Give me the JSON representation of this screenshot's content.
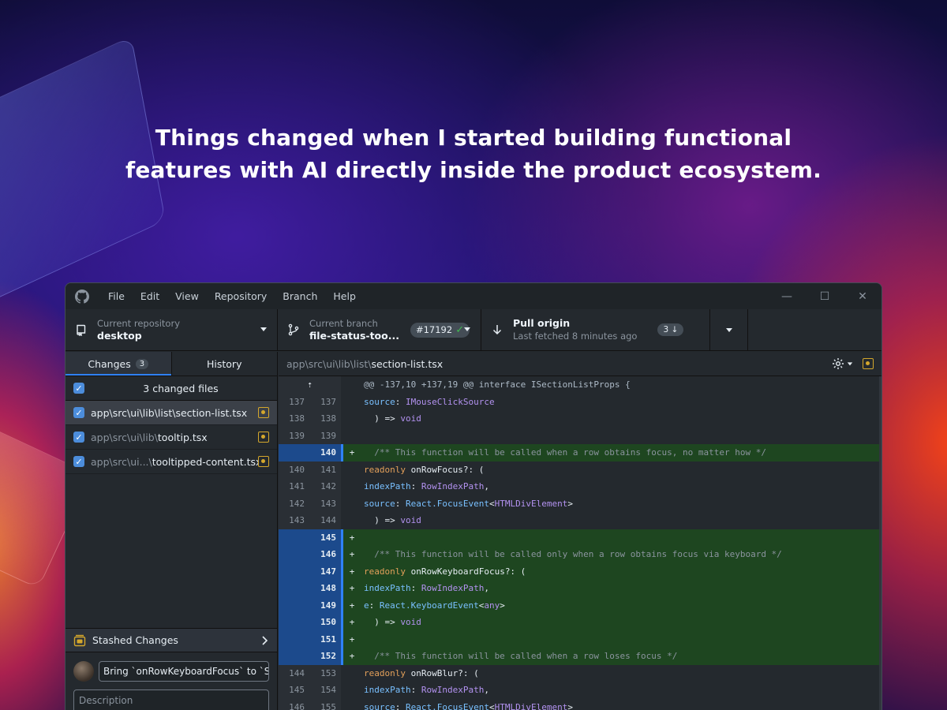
{
  "headline": {
    "line1": "Things changed when I started building functional",
    "line2": "features with AI directly inside the product ecosystem."
  },
  "menu": {
    "items": [
      "File",
      "Edit",
      "View",
      "Repository",
      "Branch",
      "Help"
    ],
    "window_controls": {
      "minimize": "—",
      "maximize": "☐",
      "close": "✕"
    }
  },
  "toolbar": {
    "repo": {
      "caption": "Current repository",
      "value": "desktop"
    },
    "branch": {
      "caption": "Current branch",
      "value": "file-status-too...",
      "pr": "#17192",
      "pr_check": "✓"
    },
    "pull": {
      "caption": "Pull origin",
      "value": "Last fetched 8 minutes ago",
      "count": "3 ↓"
    }
  },
  "sidebar": {
    "tabs": [
      {
        "label": "Changes",
        "count": "3"
      },
      {
        "label": "History"
      }
    ],
    "changed_header": "3 changed files",
    "files": [
      {
        "dir": "app\\src\\ui\\lib\\list\\",
        "name": "section-list.tsx"
      },
      {
        "dir": "app\\src\\ui\\lib\\",
        "name": "tooltip.tsx"
      },
      {
        "dir": "app\\src\\ui...\\",
        "name": "tooltipped-content.tsx"
      }
    ],
    "stash_label": "Stashed Changes",
    "summary_value": "Bring `onRowKeyboardFocus` to `Se",
    "description_placeholder": "Description"
  },
  "diff": {
    "path_dir": "app\\src\\ui\\lib\\list\\",
    "path_file": "section-list.tsx",
    "hunk_expand": "⇡",
    "hunk": "@@ -137,10 +137,19 @@ interface ISectionListProps {",
    "lines": [
      {
        "old": "137",
        "new": "137",
        "sign": "",
        "text": "    source: IMouseClickSource"
      },
      {
        "old": "138",
        "new": "138",
        "sign": "",
        "text": "  ) => void"
      },
      {
        "old": "139",
        "new": "139",
        "sign": "",
        "text": ""
      },
      {
        "old": "",
        "new": "140",
        "sign": "+",
        "text": "  /** This function will be called when a row obtains focus, no matter how */"
      },
      {
        "old": "140",
        "new": "141",
        "sign": "",
        "text": "  readonly onRowFocus?: ("
      },
      {
        "old": "141",
        "new": "142",
        "sign": "",
        "text": "    indexPath: RowIndexPath,"
      },
      {
        "old": "142",
        "new": "143",
        "sign": "",
        "text": "    source: React.FocusEvent<HTMLDivElement>"
      },
      {
        "old": "143",
        "new": "144",
        "sign": "",
        "text": "  ) => void"
      },
      {
        "old": "",
        "new": "145",
        "sign": "+",
        "text": ""
      },
      {
        "old": "",
        "new": "146",
        "sign": "+",
        "text": "  /** This function will be called only when a row obtains focus via keyboard */"
      },
      {
        "old": "",
        "new": "147",
        "sign": "+",
        "text": "  readonly onRowKeyboardFocus?: ("
      },
      {
        "old": "",
        "new": "148",
        "sign": "+",
        "text": "    indexPath: RowIndexPath,"
      },
      {
        "old": "",
        "new": "149",
        "sign": "+",
        "text": "    e: React.KeyboardEvent<any>"
      },
      {
        "old": "",
        "new": "150",
        "sign": "+",
        "text": "  ) => void"
      },
      {
        "old": "",
        "new": "151",
        "sign": "+",
        "text": ""
      },
      {
        "old": "",
        "new": "152",
        "sign": "+",
        "text": "  /** This function will be called when a row loses focus */"
      },
      {
        "old": "144",
        "new": "153",
        "sign": "",
        "text": "  readonly onRowBlur?: ("
      },
      {
        "old": "145",
        "new": "154",
        "sign": "",
        "text": "    indexPath: RowIndexPath,"
      },
      {
        "old": "146",
        "new": "155",
        "sign": "",
        "text": "    source: React.FocusEvent<HTMLDivElement>"
      }
    ]
  },
  "colors": {
    "accent": "#2f81f7",
    "added_line": "#1e4620",
    "modified_icon": "#d4a72c",
    "check": "#3fb950"
  },
  "icons": {
    "logo": "github-logo-icon",
    "repo": "repo-icon",
    "branch": "branch-icon",
    "pull": "arrow-down-icon",
    "settings": "gear-icon",
    "stash": "stash-icon",
    "chevron": "chevron-right-icon"
  }
}
